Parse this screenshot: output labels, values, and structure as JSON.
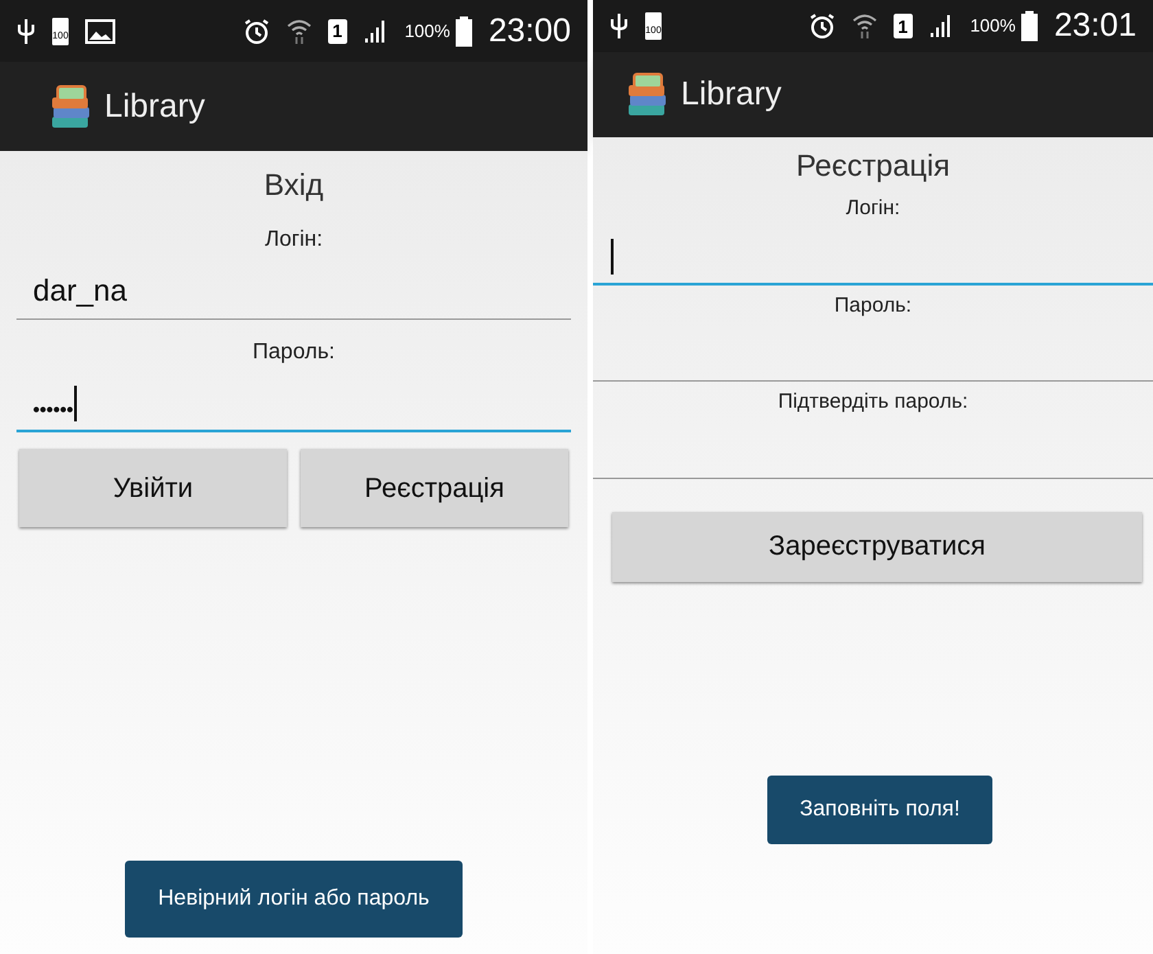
{
  "screens": [
    {
      "kind": "login",
      "status_bar": {
        "battery_icon_label": "100",
        "image_notification": true,
        "sim": "1",
        "battery_percent": "100%",
        "time": "23:00"
      },
      "app_bar": {
        "title": "Library"
      },
      "heading": "Вхід",
      "fields": [
        {
          "label": "Логін:",
          "value": "dar_na",
          "focused": false
        },
        {
          "label": "Пароль:",
          "value": "••••••",
          "focused": true
        }
      ],
      "buttons": [
        "Увійти",
        "Реєстрація"
      ],
      "toast": "Невірний логін або пароль"
    },
    {
      "kind": "register",
      "status_bar": {
        "battery_icon_label": "100",
        "image_notification": false,
        "sim": "1",
        "battery_percent": "100%",
        "time": "23:01"
      },
      "app_bar": {
        "title": "Library"
      },
      "heading": "Реєстрація",
      "fields": [
        {
          "label": "Логін:",
          "focused": true
        },
        {
          "label": "Пароль:",
          "focused": false
        },
        {
          "label": "Підтвердіть пароль:",
          "focused": false
        }
      ],
      "buttons": [
        "Зареєструватися"
      ],
      "toast": "Заповніть поля!"
    }
  ]
}
